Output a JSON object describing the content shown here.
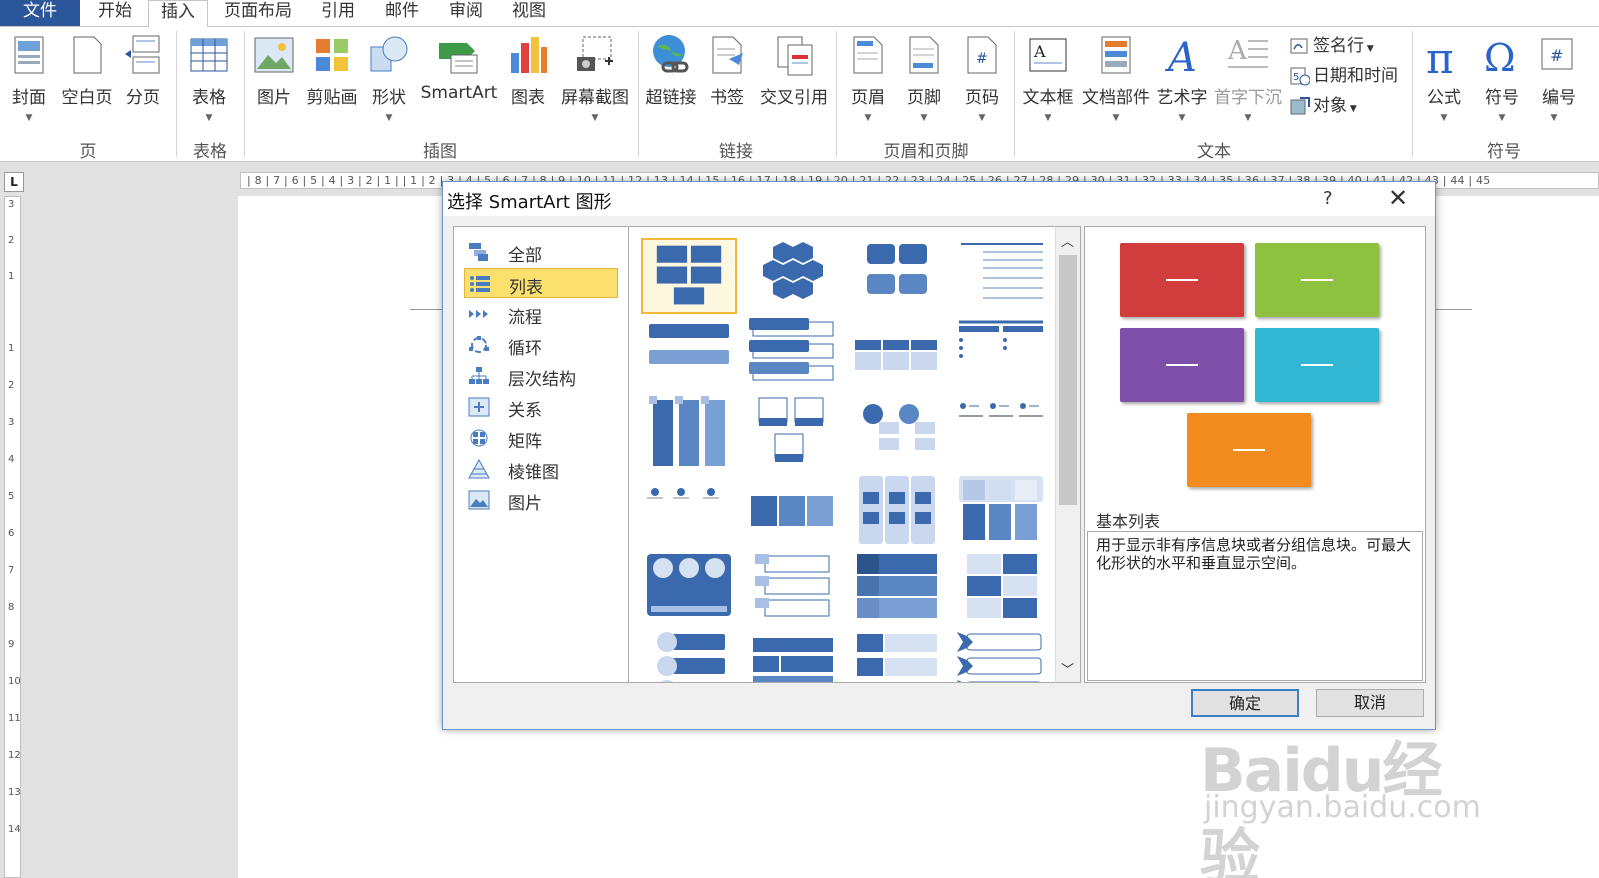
{
  "tabs": [
    {
      "name": "file",
      "label": "文件"
    },
    {
      "name": "home",
      "label": "开始"
    },
    {
      "name": "insert",
      "label": "插入"
    },
    {
      "name": "layout",
      "label": "页面布局"
    },
    {
      "name": "references",
      "label": "引用"
    },
    {
      "name": "mailings",
      "label": "邮件"
    },
    {
      "name": "review",
      "label": "审阅"
    },
    {
      "name": "view",
      "label": "视图"
    }
  ],
  "ribbon": {
    "buttons": [
      {
        "label": "封面",
        "icon": "cover-page-icon"
      },
      {
        "label": "空白页",
        "icon": "blank-page-icon"
      },
      {
        "label": "分页",
        "icon": "page-break-icon"
      },
      {
        "label": "表格",
        "icon": "table-icon"
      },
      {
        "label": "图片",
        "icon": "picture-icon"
      },
      {
        "label": "剪贴画",
        "icon": "clip-art-icon"
      },
      {
        "label": "形状",
        "icon": "shapes-icon"
      },
      {
        "label": "SmartArt",
        "icon": "smartart-icon"
      },
      {
        "label": "图表",
        "icon": "chart-icon"
      },
      {
        "label": "屏幕截图",
        "icon": "screenshot-icon"
      },
      {
        "label": "超链接",
        "icon": "hyperlink-icon"
      },
      {
        "label": "书签",
        "icon": "bookmark-icon"
      },
      {
        "label": "交叉引用",
        "icon": "cross-reference-icon"
      },
      {
        "label": "页眉",
        "icon": "header-icon"
      },
      {
        "label": "页脚",
        "icon": "footer-icon"
      },
      {
        "label": "页码",
        "icon": "page-number-icon"
      },
      {
        "label": "文本框",
        "icon": "text-box-icon"
      },
      {
        "label": "文档部件",
        "icon": "quick-parts-icon"
      },
      {
        "label": "艺术字",
        "icon": "wordart-icon"
      },
      {
        "label": "首字下沉",
        "icon": "drop-cap-icon"
      },
      {
        "label": "公式",
        "icon": "equation-icon"
      },
      {
        "label": "符号",
        "icon": "symbol-icon"
      },
      {
        "label": "编号",
        "icon": "number-icon"
      }
    ],
    "small_buttons": [
      {
        "label": "签名行",
        "icon": "signature-line-icon"
      },
      {
        "label": "日期和时间",
        "icon": "date-time-icon"
      },
      {
        "label": "对象",
        "icon": "object-icon"
      }
    ],
    "groups": [
      "页",
      "表格",
      "插图",
      "链接",
      "页眉和页脚",
      "文本",
      "符号"
    ]
  },
  "ruler": {
    "corner": "L",
    "horizontal": "| 8 | 7 | 6 | 5 | 4 | 3 | 2 | 1 |   | 1 | 2 | 3 | 4 | 5 | 6 | 7 | 8 | 9 | 10 | 11 | 12 | 13 | 14 | 15 | 16 | 17 | 18 | 19 | 20 | 21 | 22 | 23 | 24 | 25 | 26 | 27 | 28 | 29 | 30 | 31 | 32 | 33 | 34 | 35 | 36 | 37 | 38 | 39 | 40 | 41 | 42 | 43 | 44 | 45",
    "vertical": [
      "3",
      "2",
      "1",
      "1",
      "2",
      "3",
      "4",
      "5",
      "6",
      "7",
      "8",
      "9",
      "10",
      "11",
      "12",
      "13",
      "14"
    ]
  },
  "dialog": {
    "title": "选择 SmartArt 图形",
    "help": "?",
    "close": "✕",
    "categories": [
      {
        "label": "全部",
        "icon": "all-icon"
      },
      {
        "label": "列表",
        "icon": "list-icon"
      },
      {
        "label": "流程",
        "icon": "process-icon"
      },
      {
        "label": "循环",
        "icon": "cycle-icon"
      },
      {
        "label": "层次结构",
        "icon": "hierarchy-icon"
      },
      {
        "label": "关系",
        "icon": "relationship-icon"
      },
      {
        "label": "矩阵",
        "icon": "matrix-icon"
      },
      {
        "label": "棱锥图",
        "icon": "pyramid-icon"
      },
      {
        "label": "图片",
        "icon": "picture-category-icon"
      }
    ],
    "selected_category": "列表",
    "preview": {
      "title": "基本列表",
      "description": "用于显示非有序信息块或者分组信息块。可最大化形状的水平和垂直显示空间。",
      "colors": [
        "#d13c3c",
        "#8dc13f",
        "#7e4fa8",
        "#31b7d4",
        "#f28c1e"
      ]
    },
    "ok_label": "确定",
    "cancel_label": "取消"
  },
  "watermark": {
    "logo": "Baidu经验",
    "url": "jingyan.baidu.com"
  }
}
